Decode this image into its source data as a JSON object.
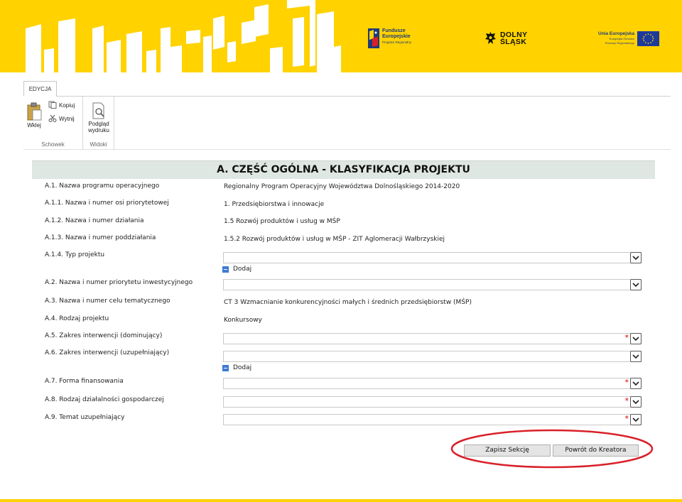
{
  "banner": {
    "fe_logo": {
      "line1": "Fundusze",
      "line2": "Europejskie",
      "line3": "Program Regionalny"
    },
    "ds_logo": {
      "line1": "DOLNY",
      "line2": "ŚLĄSK"
    },
    "ue_logo": {
      "line1": "Unia Europejska",
      "line2": "Europejski Fundusz",
      "line3": "Rozwoju Regionalnego"
    },
    "colors": {
      "background": "#ffd200",
      "blocks": "#ffffff",
      "brand_blue": "#1e3a7b"
    }
  },
  "ribbon": {
    "tab": "EDYCJA",
    "paste": "Wklej",
    "copy": "Kopiuj",
    "cut": "Wytnij",
    "preview_line1": "Podgląd",
    "preview_line2": "wydruku",
    "group_clipboard": "Schowek",
    "group_views": "Widoki"
  },
  "section_title": "A. CZĘŚĆ OGÓLNA - KLASYFIKACJA PROJEKTU",
  "fields": {
    "a1": {
      "label": "A.1. Nazwa programu operacyjnego",
      "value": "Regionalny Program Operacyjny Województwa Dolnośląskiego 2014-2020"
    },
    "a11": {
      "label": "A.1.1. Nazwa i numer osi priorytetowej",
      "value": "1. Przedsiębiorstwa i innowacje"
    },
    "a12": {
      "label": "A.1.2. Nazwa i numer działania",
      "value": "1.5 Rozwój produktów i usług w MŚP"
    },
    "a13": {
      "label": "A.1.3. Nazwa i numer poddziałania",
      "value": "1.5.2 Rozwój produktów i usług w MŚP - ZIT Aglomeracji Wałbrzyskiej"
    },
    "a14": {
      "label": "A.1.4. Typ projektu",
      "value": ""
    },
    "a2": {
      "label": "A.2. Nazwa i numer priorytetu inwestycyjnego",
      "value": ""
    },
    "a3": {
      "label": "A.3. Nazwa i numer celu tematycznego",
      "value": "CT 3 Wzmacnianie konkurencyjności małych i średnich przedsiębiorstw (MŚP)"
    },
    "a4": {
      "label": "A.4. Rodzaj projektu",
      "value": "Konkursowy"
    },
    "a5": {
      "label": "A.5. Zakres interwencji (dominujący)",
      "value": ""
    },
    "a6": {
      "label": "A.6. Zakres interwencji (uzupełniający)",
      "value": ""
    },
    "a7": {
      "label": "A.7. Forma finansowania",
      "value": ""
    },
    "a8": {
      "label": "A.8. Rodzaj działalności gospodarczej",
      "value": ""
    },
    "a9": {
      "label": "A.9. Temat uzupełniający",
      "value": ""
    }
  },
  "add_label": "Dodaj",
  "required_mark": "*",
  "buttons": {
    "save": "Zapisz Sekcję",
    "back": "Powrót do Kreatora"
  },
  "accent": {
    "ring": "#d9202a",
    "add_icon": "#3c7ad6",
    "header_bg": "#dfe7e2"
  }
}
